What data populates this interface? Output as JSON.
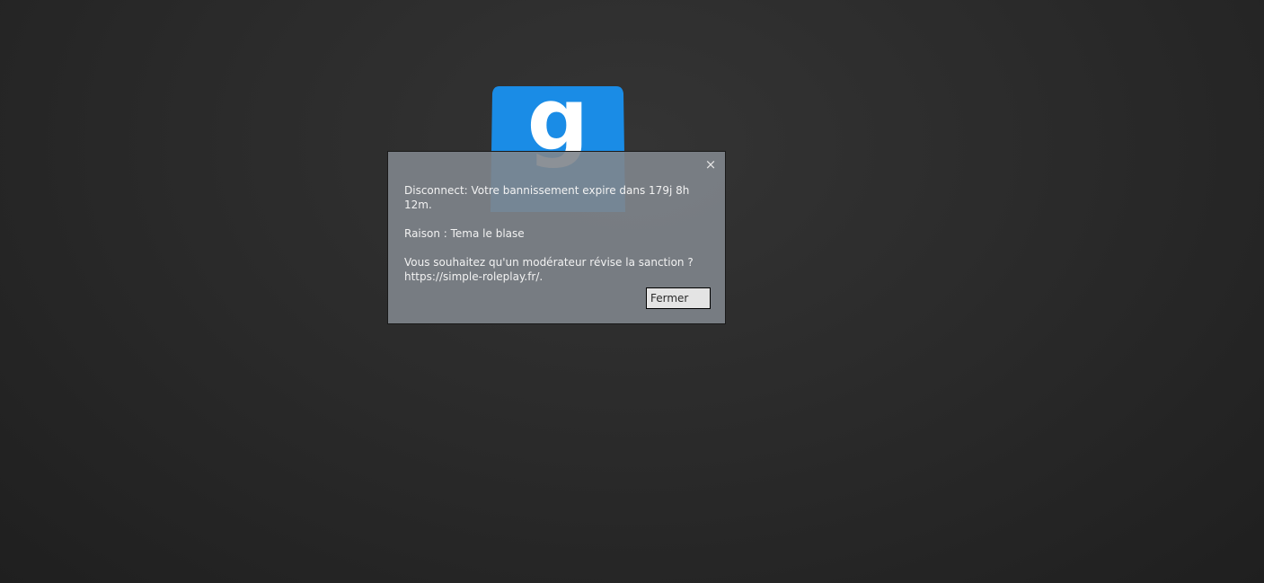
{
  "colors": {
    "logo_blue": "#1a8ce6",
    "dialog_bg": "#80858c",
    "dialog_text": "#f2f2f2",
    "button_bg": "#e4e4e4"
  },
  "dialog": {
    "close_icon": "×",
    "line_disconnect": "Disconnect: Votre bannissement expire dans 179j 8h 12m.",
    "line_reason": "Raison : Tema le blase",
    "line_review": "Vous souhaitez qu'un modérateur révise la sanction ?",
    "line_url": "https://simple-roleplay.fr/.",
    "close_button_label": "Fermer"
  }
}
